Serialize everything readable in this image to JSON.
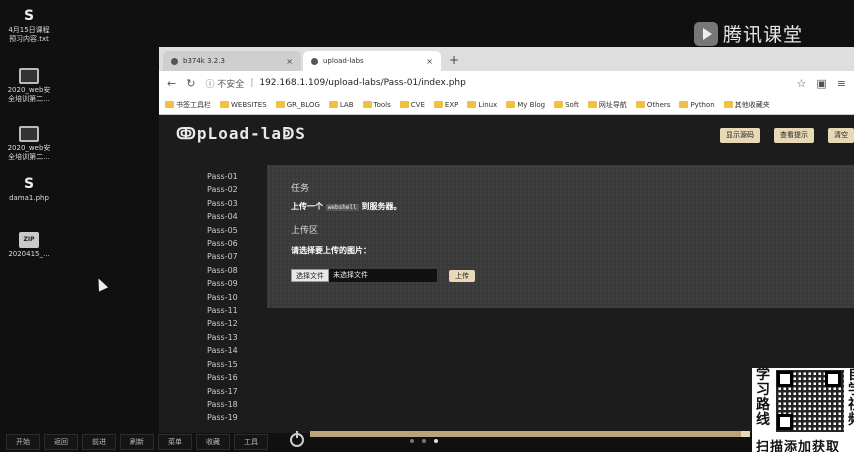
{
  "desktop": {
    "icons": [
      {
        "glyph": "S",
        "line1": "4月15日课程",
        "line2": "预习内容.txt"
      },
      {
        "glyph": "laptop",
        "line1": "2020_web安",
        "line2": "全培训第二..."
      },
      {
        "glyph": "laptop",
        "line1": "2020_web安",
        "line2": "全培训第二..."
      },
      {
        "glyph": "S",
        "line1": "dama1.php",
        "line2": ""
      },
      {
        "glyph": "ZIP",
        "line1": "2020415_...",
        "line2": ""
      }
    ]
  },
  "watermark": {
    "brand": "腾讯课堂"
  },
  "browser": {
    "tabs": [
      {
        "title": "b374k 3.2.3",
        "close": "×"
      },
      {
        "title": "upload-labs",
        "close": "×"
      }
    ],
    "new_tab": "+",
    "address": {
      "back": "←",
      "reload": "↻",
      "security": "ⓘ 不安全",
      "url": "192.168.1.109/upload-labs/Pass-01/index.php",
      "star": "☆"
    },
    "bookmarks": [
      "书签工具栏",
      "WEBSITES",
      "GR_BLOG",
      "LAB",
      "Tools",
      "CVE",
      "EXP",
      "Linux",
      "My Blog",
      "Soft",
      "网址导航",
      "Others",
      "Python",
      "其他收藏夹"
    ]
  },
  "page": {
    "logo": "ↂpLoad-laↁS",
    "buttons": {
      "show_source": "显示源码",
      "view_hint": "查看提示",
      "clear": "清空"
    },
    "menu": [
      "Pass-01",
      "Pass-02",
      "Pass-03",
      "Pass-04",
      "Pass-05",
      "Pass-06",
      "Pass-07",
      "Pass-08",
      "Pass-09",
      "Pass-10",
      "Pass-11",
      "Pass-12",
      "Pass-13",
      "Pass-14",
      "Pass-15",
      "Pass-16",
      "Pass-17",
      "Pass-18",
      "Pass-19"
    ],
    "task_heading": "任务",
    "task_pre": "上传一个",
    "task_code": "webshell",
    "task_post": "到服务器。",
    "upload_heading": "上传区",
    "upload_prompt": "请选择要上传的图片：",
    "file_button": "选择文件",
    "file_status": "未选择文件",
    "upload_button": "上传"
  },
  "promo": {
    "vertical_left": [
      "学",
      "习",
      "路",
      "线"
    ],
    "vertical_right": [
      "自",
      "学",
      "视",
      "频"
    ],
    "bottom": "扫描添加获取"
  },
  "taskbar": {
    "items": [
      "开始",
      "返回",
      "前进",
      "刷新",
      "菜单",
      "收藏",
      "工具"
    ]
  },
  "video": {
    "progress": 0.98
  }
}
